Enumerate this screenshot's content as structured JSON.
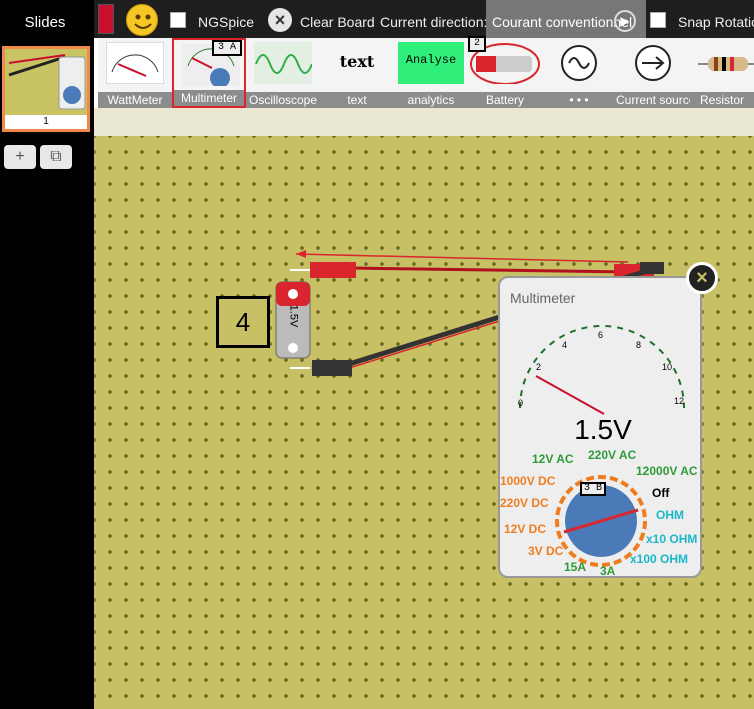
{
  "slides": {
    "title": "Slides",
    "thumb_number": "1",
    "add_label": "+",
    "copy_label": "⧉"
  },
  "toolbar": {
    "ngspice_label": "NGSpice",
    "clear_label": "Clear Board",
    "direction_label": "Current direction:",
    "convention_value": "Courant conventionnel",
    "snap_label": "Snap Rotatio"
  },
  "palette": [
    {
      "label": "WattMeter"
    },
    {
      "label": "Multimeter",
      "callout": "3 A"
    },
    {
      "label": "Oscilloscope"
    },
    {
      "label": "text",
      "icon_text": "text"
    },
    {
      "label": "analytics",
      "icon_text": "Analyse"
    },
    {
      "label": "Battery",
      "callout": "2"
    },
    {
      "label": "• • •"
    },
    {
      "label": "Current source"
    },
    {
      "label": "Resistor"
    }
  ],
  "board": {
    "label_4": "4",
    "battery_label": "1.5V"
  },
  "multimeter": {
    "title": "Multimeter",
    "reading": "1.5V",
    "callout": "3 B",
    "scale": [
      "0",
      "2",
      "4",
      "6",
      "8",
      "10",
      "12"
    ],
    "ranges": [
      {
        "t": "12V AC",
        "c": "#2f9a3a"
      },
      {
        "t": "220V AC",
        "c": "#2f9a3a"
      },
      {
        "t": "12000V AC",
        "c": "#2f9a3a"
      },
      {
        "t": "1000V DC",
        "c": "#ef7d1f"
      },
      {
        "t": "220V DC",
        "c": "#ef7d1f"
      },
      {
        "t": "Off",
        "c": "#000000"
      },
      {
        "t": "OHM",
        "c": "#18b8c9"
      },
      {
        "t": "12V DC",
        "c": "#ef7d1f"
      },
      {
        "t": "x10 OHM",
        "c": "#18b8c9"
      },
      {
        "t": "3V DC",
        "c": "#ef7d1f"
      },
      {
        "t": "x100 OHM",
        "c": "#18b8c9"
      },
      {
        "t": "15A",
        "c": "#2f9a3a"
      },
      {
        "t": "3A",
        "c": "#2f9a3a"
      }
    ]
  }
}
